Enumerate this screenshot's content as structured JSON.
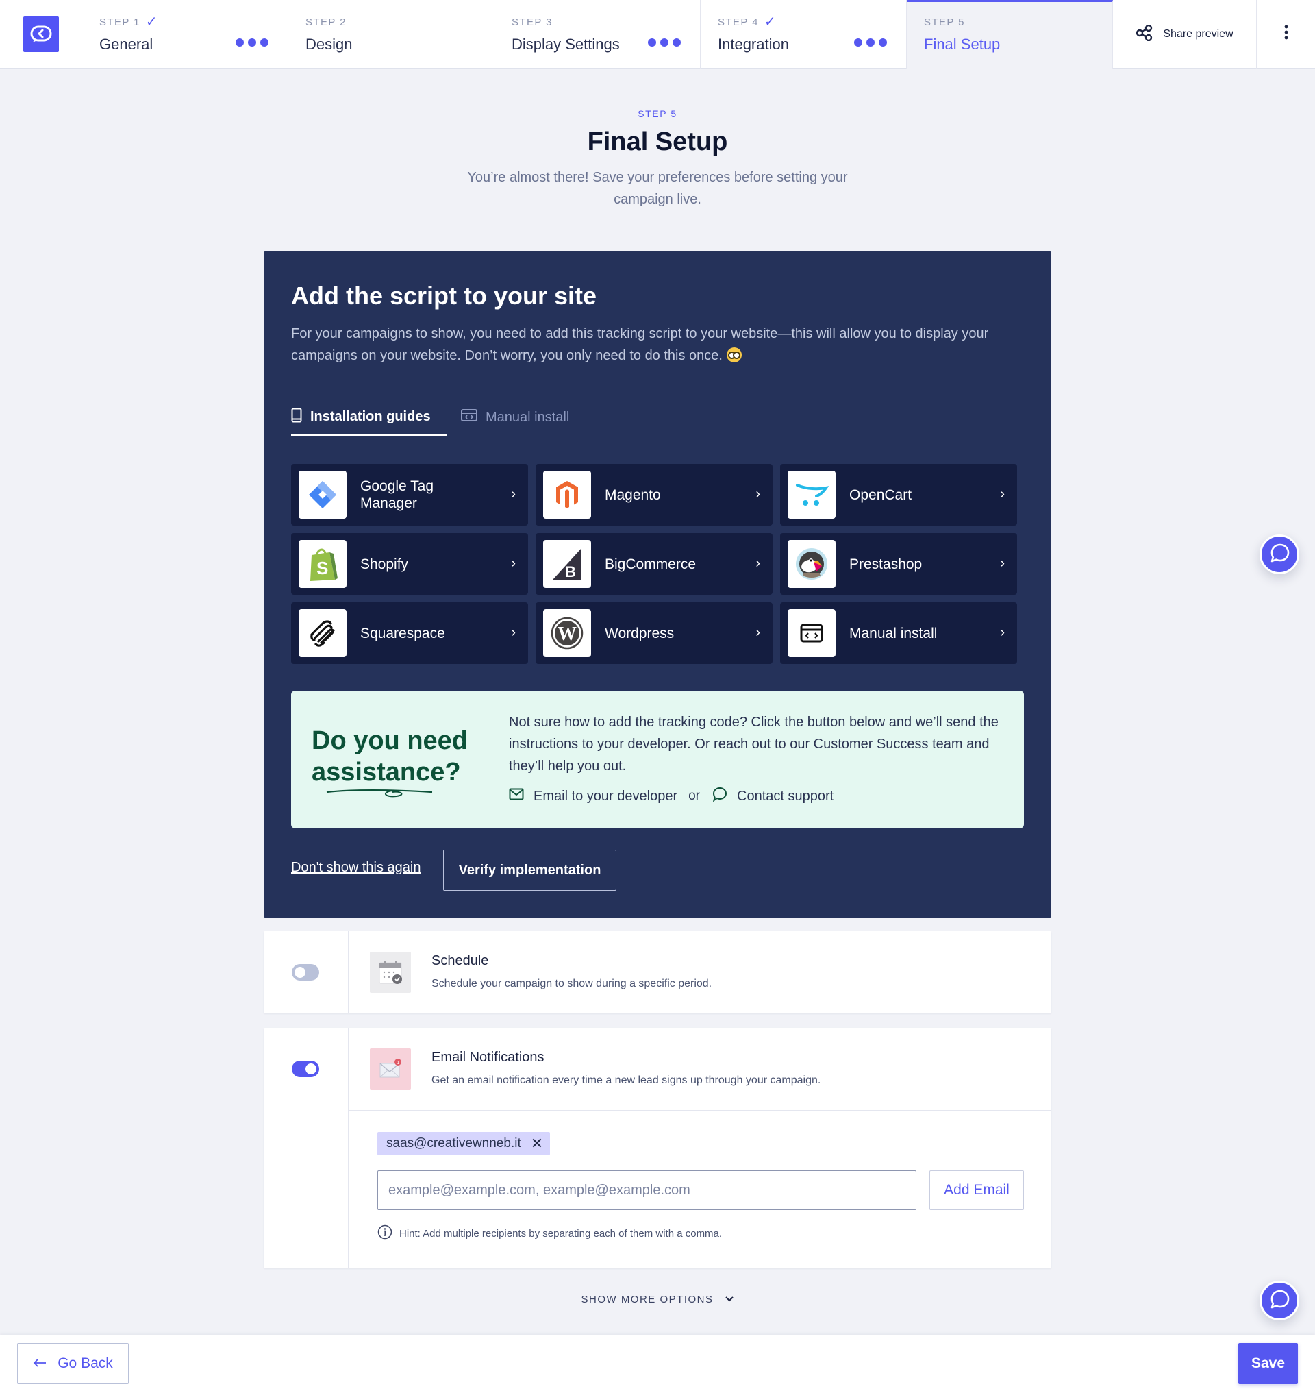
{
  "topbar": {
    "logo_icon": "back-chat-logo-icon",
    "steps": [
      {
        "label": "STEP 1",
        "name": "General",
        "completed": true,
        "has_menu": true,
        "active": false
      },
      {
        "label": "STEP 2",
        "name": "Design",
        "completed": false,
        "has_menu": false,
        "active": false
      },
      {
        "label": "STEP 3",
        "name": "Display Settings",
        "completed": false,
        "has_menu": true,
        "active": false
      },
      {
        "label": "STEP 4",
        "name": "Integration",
        "completed": true,
        "has_menu": true,
        "active": false
      },
      {
        "label": "STEP 5",
        "name": "Final Setup",
        "completed": false,
        "has_menu": false,
        "active": true
      }
    ],
    "check_glyph": "✓",
    "share_label": "Share preview",
    "share_icon": "share-icon",
    "more_icon": "kebab-menu-icon"
  },
  "header": {
    "eyebrow": "STEP 5",
    "title": "Final Setup",
    "subtitle": "You’re almost there! Save your preferences before setting your campaign live."
  },
  "script_panel": {
    "title": "Add the script to your site",
    "description": "For your campaigns to show, you need to add this tracking script to your website—this will allow you to display your campaigns on your website. Don’t worry, you only need to do this once.",
    "emoji": "nerd-face-emoji",
    "tabs": [
      {
        "label": "Installation guides",
        "icon": "book-icon",
        "active": true
      },
      {
        "label": "Manual install",
        "icon": "code-window-icon",
        "active": false
      }
    ],
    "integrations": [
      {
        "name": "Google Tag Manager",
        "icon": "google-tag-manager-logo"
      },
      {
        "name": "Magento",
        "icon": "magento-logo"
      },
      {
        "name": "OpenCart",
        "icon": "opencart-logo"
      },
      {
        "name": "Shopify",
        "icon": "shopify-logo"
      },
      {
        "name": "BigCommerce",
        "icon": "bigcommerce-logo"
      },
      {
        "name": "Prestashop",
        "icon": "prestashop-logo"
      },
      {
        "name": "Squarespace",
        "icon": "squarespace-logo"
      },
      {
        "name": "Wordpress",
        "icon": "wordpress-logo"
      },
      {
        "name": "Manual install",
        "icon": "code-window-icon"
      }
    ],
    "chevron": "›",
    "assistance": {
      "title_line1": "Do you need",
      "title_line2": "assistance?",
      "text": "Not sure how to add the tracking code? Click the button below and we’ll send the instructions to your developer. Or reach out to our Customer Success team and they’ll help you out.",
      "email_link": "Email to your developer",
      "or": "or",
      "support_link": "Contact support"
    },
    "dont_show_label": "Don't show this again",
    "verify_label": "Verify implementation"
  },
  "options": {
    "schedule": {
      "title": "Schedule",
      "description": "Schedule your campaign to show during a specific period.",
      "enabled": false,
      "icon": "calendar-icon"
    },
    "email_notifications": {
      "title": "Email Notifications",
      "description": "Get an email notification every time a new lead signs up through your campaign.",
      "enabled": true,
      "icon": "envelope-notification-icon",
      "recipients": [
        "saas@creativewnneb.it"
      ],
      "remove_glyph": "✕",
      "input_placeholder": "example@example.com, example@example.com",
      "input_value": "",
      "add_label": "Add Email",
      "hint": "Hint: Add multiple recipients by separating each of them with a comma."
    }
  },
  "show_more_label": "SHOW MORE OPTIONS",
  "footer": {
    "back_label": "Go Back",
    "save_label": "Save"
  },
  "colors": {
    "accent": "#5557f0",
    "panel": "#25325a",
    "card": "#141d40",
    "assist_bg": "#e4f8f1",
    "assist_title": "#0c5138",
    "chip_bg": "#d6d5fd"
  }
}
